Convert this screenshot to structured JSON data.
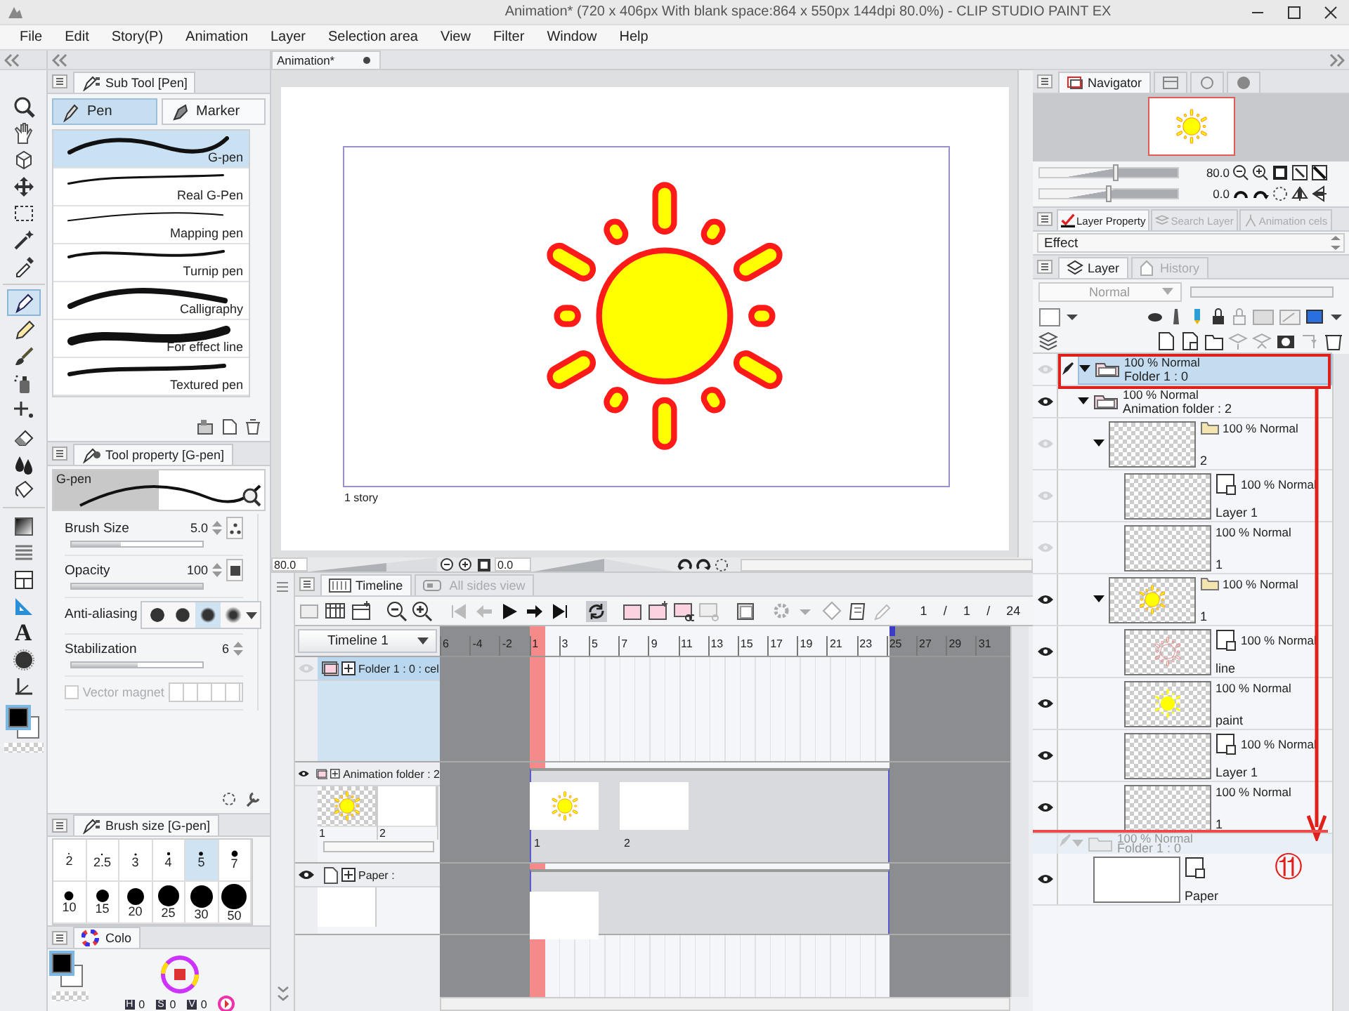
{
  "title_bar": {
    "title": "Animation* (720 x 406px With blank space:864 x 550px 144dpi 80.0%) - CLIP STUDIO PAINT EX"
  },
  "menu": [
    "File",
    "Edit",
    "Story(P)",
    "Animation",
    "Layer",
    "Selection area",
    "View",
    "Filter",
    "Window",
    "Help"
  ],
  "tools": [
    {
      "kind": "zoom",
      "selected": false
    },
    {
      "kind": "hand",
      "selected": false
    },
    {
      "kind": "rotate",
      "selected": false
    },
    {
      "kind": "move",
      "selected": false
    },
    {
      "kind": "select",
      "selected": false
    },
    {
      "kind": "wand",
      "selected": false
    },
    {
      "kind": "dropper",
      "selected": false
    },
    {
      "kind": "pen",
      "selected": true
    },
    {
      "kind": "pencil",
      "selected": false
    },
    {
      "kind": "brush",
      "selected": false
    },
    {
      "kind": "airbrush",
      "selected": false
    },
    {
      "kind": "decoration",
      "selected": false
    },
    {
      "kind": "eraser",
      "selected": false
    },
    {
      "kind": "fill",
      "selected": false
    },
    {
      "kind": "bucket",
      "selected": false
    },
    {
      "kind": "gradient",
      "selected": false
    },
    {
      "kind": "blend",
      "selected": false
    },
    {
      "kind": "frame",
      "selected": false
    },
    {
      "kind": "ruler",
      "selected": false
    },
    {
      "kind": "text",
      "glyph": "A",
      "selected": false
    },
    {
      "kind": "blur",
      "selected": false
    },
    {
      "kind": "correct",
      "selected": false
    }
  ],
  "sub_tool": {
    "tab": "Sub Tool [Pen]",
    "groups": [
      {
        "label": "Pen",
        "selected": true
      },
      {
        "label": "Marker",
        "selected": false
      }
    ],
    "items": [
      {
        "label": "G-pen",
        "selected": true
      },
      {
        "label": "Real G-Pen",
        "selected": false
      },
      {
        "label": "Mapping pen",
        "selected": false
      },
      {
        "label": "Turnip pen",
        "selected": false
      },
      {
        "label": "Calligraphy",
        "selected": false
      },
      {
        "label": "For effect line",
        "selected": false
      },
      {
        "label": "Textured pen",
        "selected": false
      }
    ]
  },
  "tool_property": {
    "tab": "Tool property [G-pen]",
    "preview_label": "G-pen",
    "brush_size": {
      "label": "Brush Size",
      "value": "5.0",
      "level": 0.38
    },
    "opacity": {
      "label": "Opacity",
      "value": "100",
      "level": 1
    },
    "anti_aliasing": {
      "label": "Anti-aliasing",
      "options": [
        {
          "selected": false
        },
        {
          "selected": false
        },
        {
          "selected": true
        },
        {
          "selected": false
        }
      ]
    },
    "stabilization": {
      "label": "Stabilization",
      "value": "6",
      "level": 0.5
    },
    "vector_magnet": {
      "label": "Vector magnet",
      "checked": false,
      "disabled": true
    }
  },
  "brush_size": {
    "tab": "Brush size [G-pen]",
    "sizes": [
      {
        "label": "2",
        "selected": false
      },
      {
        "label": "2.5",
        "selected": false
      },
      {
        "label": "3",
        "selected": false
      },
      {
        "label": "4",
        "selected": false
      },
      {
        "label": "5",
        "selected": true
      },
      {
        "label": "7",
        "selected": false
      },
      {
        "label": "10",
        "selected": false
      },
      {
        "label": "15",
        "selected": false
      },
      {
        "label": "20",
        "selected": false
      },
      {
        "label": "25",
        "selected": false
      },
      {
        "label": "30",
        "selected": false
      },
      {
        "label": "50",
        "selected": false
      }
    ]
  },
  "color": {
    "tab": "Colo",
    "readouts": [
      {
        "label": "H",
        "value": "0"
      },
      {
        "label": "S",
        "value": "0"
      },
      {
        "label": "V",
        "value": "0"
      }
    ]
  },
  "canvas": {
    "tab": "Animation*",
    "story_label": "1 story",
    "zoom": "80.0",
    "angle": "0.0",
    "zoom_slider": {
      "level": 0.6
    },
    "angle_slider": {
      "level": 0.5
    }
  },
  "timeline": {
    "tabs": [
      {
        "label": "Timeline",
        "selected": true
      },
      {
        "label": "All sides view",
        "selected": false
      }
    ],
    "counter": [
      "1",
      "/",
      "1",
      "/",
      "24"
    ],
    "name": "Timeline 1",
    "ruler": [
      "6",
      "-4",
      "-2",
      "1",
      "3",
      "5",
      "7",
      "9",
      "11",
      "13",
      "15",
      "17",
      "19",
      "21",
      "23",
      "25",
      "27",
      "29",
      "31"
    ],
    "tracks": [
      {
        "kind": "folder",
        "label": "Folder 1 : 0 : cel",
        "visible": false,
        "selected": true
      },
      {
        "kind": "animation",
        "label": "Animation folder : 2",
        "visible": true,
        "selected": false,
        "thumbs": [
          {
            "kind": "sun",
            "label": "1"
          },
          {
            "kind": "white",
            "label": "2"
          }
        ],
        "cels": [
          {
            "kind": "sun",
            "label": "1"
          },
          {
            "kind": "white",
            "label": "2"
          }
        ]
      },
      {
        "kind": "paper",
        "label": "Paper :",
        "visible": true,
        "selected": false
      }
    ]
  },
  "navigator": {
    "tabs": [
      {
        "kind": "navigator",
        "label": "Navigator",
        "selected": true
      },
      {
        "kind": "window",
        "selected": false
      },
      {
        "kind": "ring",
        "selected": false
      },
      {
        "kind": "circle",
        "selected": false
      }
    ],
    "zoom": "80.0",
    "angle": "0.0",
    "zoom_slider": {
      "level": 0.55
    },
    "angle_slider": {
      "level": 0.5
    }
  },
  "layer_property": {
    "tabs": [
      {
        "label": "Layer Property",
        "selected": true
      },
      {
        "label": "Search Layer",
        "selected": false
      },
      {
        "label": "Animation cels",
        "selected": false
      }
    ],
    "effect": "Effect"
  },
  "layer_panel": {
    "tabs": [
      {
        "label": "Layer",
        "selected": true
      },
      {
        "label": "History",
        "selected": false
      }
    ],
    "blend_mode": "Normal",
    "opacity": {
      "level": 1
    },
    "layers": [
      {
        "kind": "folder",
        "mode": "100 % Normal",
        "name": "Folder 1 : 0",
        "visible": false,
        "selected": true,
        "expanded": true,
        "editing": true
      },
      {
        "kind": "folder",
        "mode": "100 % Normal",
        "name": "Animation folder : 2",
        "visible": true,
        "selected": false,
        "expanded": true,
        "editing": false,
        "children": [
          {
            "kind": "cel_folder",
            "mode": "100 % Normal",
            "name": "2",
            "visible": false,
            "selected": false,
            "expanded": true,
            "thumbnail": {
              "kind": "transparent"
            },
            "children": [
              {
                "kind": "raster",
                "mode": "100 % Normal",
                "name": "Layer 1",
                "visible": false,
                "selected": false,
                "thumbnail": {
                  "kind": "transparent"
                }
              },
              {
                "kind": "cel",
                "mode": "100 % Normal",
                "name": "1",
                "visible": false,
                "selected": false,
                "thumbnail": {
                  "kind": "transparent"
                }
              }
            ]
          },
          {
            "kind": "cel_folder",
            "mode": "100 % Normal",
            "name": "1",
            "visible": true,
            "selected": false,
            "expanded": true,
            "thumbnail": {
              "kind": "sun"
            },
            "children": [
              {
                "kind": "raster",
                "mode": "100 % Normal",
                "name": "line",
                "visible": true,
                "selected": false,
                "thumbnail": {
                  "kind": "sun_line"
                }
              },
              {
                "kind": "cel",
                "mode": "100 % Normal",
                "name": "paint",
                "visible": true,
                "selected": false,
                "thumbnail": {
                  "kind": "sun_paint"
                }
              },
              {
                "kind": "raster",
                "mode": "100 % Normal",
                "name": "Layer 1",
                "visible": true,
                "selected": false,
                "thumbnail": {
                  "kind": "transparent"
                }
              },
              {
                "kind": "cel",
                "mode": "100 % Normal",
                "name": "1",
                "visible": true,
                "selected": false,
                "thumbnail": {
                  "kind": "transparent"
                }
              }
            ]
          }
        ]
      },
      {
        "kind": "drag_ghost",
        "mode": "100 % Normal",
        "name": "Folder 1 : 0"
      },
      {
        "kind": "paper",
        "name": "Paper",
        "visible": true,
        "selected": false,
        "thumbnail": {
          "kind": "white"
        }
      }
    ]
  },
  "annotation": {
    "step": "⑪"
  }
}
